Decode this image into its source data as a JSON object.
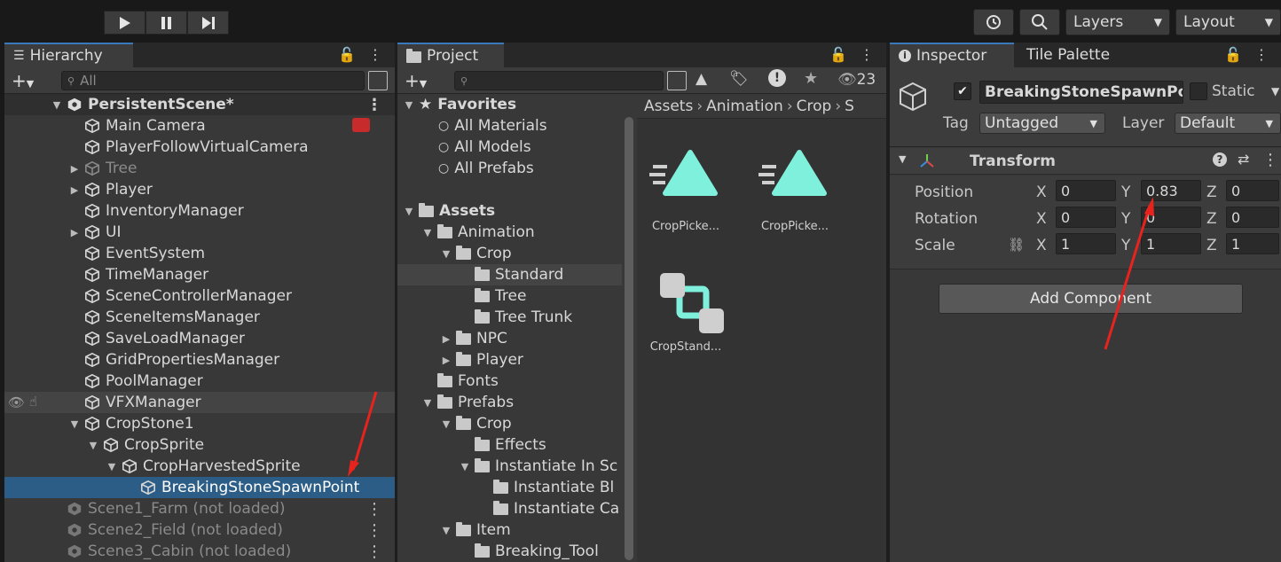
{
  "toolbar": {
    "play_icon": "play-icon",
    "pause_icon": "pause-icon",
    "step_icon": "step-icon",
    "layers": "Layers",
    "layout": "Layout"
  },
  "hierarchy": {
    "tab": "Hierarchy",
    "search_placeholder": "All",
    "scene": "PersistentScene*",
    "items": [
      "Main Camera",
      "PlayerFollowVirtualCamera",
      "Tree",
      "Player",
      "InventoryManager",
      "UI",
      "EventSystem",
      "TimeManager",
      "SceneControllerManager",
      "SceneItemsManager",
      "SaveLoadManager",
      "GridPropertiesManager",
      "PoolManager",
      "VFXManager",
      "CropStone1",
      "CropSprite",
      "CropHarvestedSprite",
      "BreakingStoneSpawnPoint"
    ],
    "unloaded": [
      "Scene1_Farm (not loaded)",
      "Scene2_Field (not loaded)",
      "Scene3_Cabin (not loaded)"
    ]
  },
  "project": {
    "tab": "Project",
    "visible_count": "23",
    "favorites": {
      "label": "Favorites",
      "items": [
        "All Materials",
        "All Models",
        "All Prefabs"
      ]
    },
    "assets_label": "Assets",
    "tree": [
      "Animation",
      "Crop",
      "Standard",
      "Tree",
      "Tree Trunk",
      "NPC",
      "Player",
      "Fonts",
      "Prefabs",
      "Crop",
      "Effects",
      "Instantiate In Sc",
      "Instantiate Bl",
      "Instantiate Ca",
      "Item",
      "Breaking_Tool"
    ],
    "breadcrumb": [
      "Assets",
      "Animation",
      "Crop",
      "S"
    ],
    "files": [
      "CropPicke...",
      "CropPicke...",
      "CropStand..."
    ]
  },
  "inspector": {
    "tab": "Inspector",
    "tab2": "Tile Palette",
    "object_name": "BreakingStoneSpawnPoi",
    "static_label": "Static",
    "tag_label": "Tag",
    "tag_value": "Untagged",
    "layer_label": "Layer",
    "layer_value": "Default",
    "component": "Transform",
    "position_label": "Position",
    "rotation_label": "Rotation",
    "scale_label": "Scale",
    "axis": {
      "x": "X",
      "y": "Y",
      "z": "Z"
    },
    "position": {
      "x": "0",
      "y": "0.83",
      "z": "0"
    },
    "rotation": {
      "x": "0",
      "y": "0",
      "z": "0"
    },
    "scale": {
      "x": "1",
      "y": "1",
      "z": "1"
    },
    "add_component": "Add Component"
  },
  "colors": {
    "selection": "#2c5d87",
    "annotation_arrow": "#e8231d",
    "anim_accent": "#7ef0dc"
  }
}
